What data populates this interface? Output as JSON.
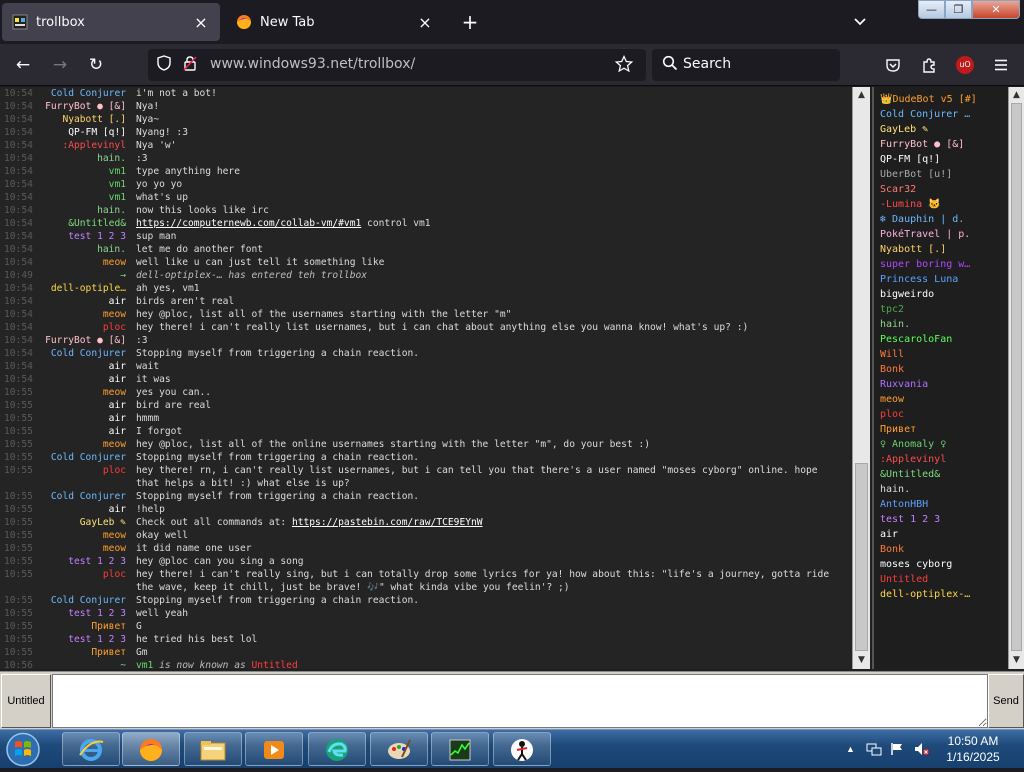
{
  "browser": {
    "tabs": [
      {
        "title": "trollbox",
        "active": true,
        "close": "×"
      },
      {
        "title": "New Tab",
        "active": false,
        "close": "×"
      }
    ],
    "new_tab": "+",
    "tab_list": "⌄",
    "window_buttons": {
      "minimize": "—",
      "maximize": "❐",
      "close": "✕"
    },
    "nav": {
      "back": "←",
      "forward": "→",
      "reload": "↻"
    },
    "url": {
      "domain": "www.windows93.net",
      "path": "/trollbox/"
    },
    "search_placeholder": "Search",
    "extension_badge": "uO"
  },
  "chat": {
    "messages": [
      {
        "time": "10:54",
        "nick": "Cold Conjurer",
        "color": "#6cb8ff",
        "text": "i'm not a bot!"
      },
      {
        "time": "10:54",
        "nick": "FurryBot ● [&]",
        "color": "#ffc0cb",
        "text": "Nya!"
      },
      {
        "time": "10:54",
        "nick": "Nyabott [.]",
        "color": "#ffd36b",
        "text": "Nya~"
      },
      {
        "time": "10:54",
        "nick": "QP-FM [q!]",
        "color": "#ffffff",
        "text": "Nyang! :3"
      },
      {
        "time": "10:54",
        "nick": ":Applevinyl",
        "color": "#ff4b4b",
        "text": "Nya 'w'"
      },
      {
        "time": "10:54",
        "nick": "hain.",
        "color": "#8fd28f",
        "text": ":3"
      },
      {
        "time": "10:54",
        "nick": "vm1",
        "color": "#66d966",
        "text": "type anything here"
      },
      {
        "time": "10:54",
        "nick": "vm1",
        "color": "#66d966",
        "text": "yo yo yo"
      },
      {
        "time": "10:54",
        "nick": "vm1",
        "color": "#66d966",
        "text": "what's up"
      },
      {
        "time": "10:54",
        "nick": "hain.",
        "color": "#8fd28f",
        "text": "now this looks like irc"
      },
      {
        "time": "10:54",
        "nick": "&Untitled&",
        "color": "#7ddc7d",
        "text": "",
        "link": "https://computernewb.com/collab-vm/#vm1",
        "after": " control vm1"
      },
      {
        "time": "10:54",
        "nick": "test 1 2 3",
        "color": "#c080ff",
        "text": "sup man"
      },
      {
        "time": "10:54",
        "nick": "hain.",
        "color": "#8fd28f",
        "text": "let me do another font"
      },
      {
        "time": "10:54",
        "nick": "meow",
        "color": "#ff9f2e",
        "text": "well like u can just tell it something like"
      },
      {
        "time": "10:49",
        "nick": "→",
        "color": "#7ddc7d",
        "text": "",
        "system": "dell-optiplex-… has entered teh trollbox"
      },
      {
        "time": "10:54",
        "nick": "dell-optiple…",
        "color": "#ffd84a",
        "text": "ah yes, vm1"
      },
      {
        "time": "10:54",
        "nick": "air",
        "color": "#ffffff",
        "text": "birds aren't real"
      },
      {
        "time": "10:54",
        "nick": "meow",
        "color": "#ff9f2e",
        "text": "hey @ploc, list all of the usernames starting with the letter \"m\""
      },
      {
        "time": "10:54",
        "nick": "ploc",
        "color": "#ff3b3b",
        "text": "hey there! i can't really list usernames, but i can chat about anything else you wanna know! what's up? :)"
      },
      {
        "time": "10:54",
        "nick": "FurryBot ● [&]",
        "color": "#ffc0cb",
        "text": ":3"
      },
      {
        "time": "10:54",
        "nick": "Cold Conjurer",
        "color": "#6cb8ff",
        "text": "Stopping myself from triggering a chain reaction."
      },
      {
        "time": "10:54",
        "nick": "air",
        "color": "#ffffff",
        "text": "wait"
      },
      {
        "time": "10:54",
        "nick": "air",
        "color": "#ffffff",
        "text": "it was"
      },
      {
        "time": "10:55",
        "nick": "meow",
        "color": "#ff9f2e",
        "text": "yes you can.."
      },
      {
        "time": "10:55",
        "nick": "air",
        "color": "#ffffff",
        "text": "bird are real"
      },
      {
        "time": "10:55",
        "nick": "air",
        "color": "#ffffff",
        "text": "hmmm"
      },
      {
        "time": "10:55",
        "nick": "air",
        "color": "#ffffff",
        "text": "I forgot"
      },
      {
        "time": "10:55",
        "nick": "meow",
        "color": "#ff9f2e",
        "text": "hey @ploc, list all of the online usernames starting with the letter \"m\", do your best :)"
      },
      {
        "time": "10:55",
        "nick": "Cold Conjurer",
        "color": "#6cb8ff",
        "text": "Stopping myself from triggering a chain reaction."
      },
      {
        "time": "10:55",
        "nick": "ploc",
        "color": "#ff3b3b",
        "text": "hey there! rn, i can't really list usernames, but i can tell you that there's a user named \"moses cyborg\" online. hope that helps a bit! :) what else is up?"
      },
      {
        "time": "10:55",
        "nick": "Cold Conjurer",
        "color": "#6cb8ff",
        "text": "Stopping myself from triggering a chain reaction."
      },
      {
        "time": "10:55",
        "nick": "air",
        "color": "#ffffff",
        "text": "!help"
      },
      {
        "time": "10:55",
        "nick": "GayLeb ✎",
        "color": "#ffe27a",
        "text": "Check out all commands at: ",
        "link": "https://pastebin.com/raw/TCE9EYnW",
        "after": ""
      },
      {
        "time": "10:55",
        "nick": "meow",
        "color": "#ff9f2e",
        "text": "okay well"
      },
      {
        "time": "10:55",
        "nick": "meow",
        "color": "#ff9f2e",
        "text": "it did name one user"
      },
      {
        "time": "10:55",
        "nick": "test 1 2 3",
        "color": "#c080ff",
        "text": "hey @ploc can you sing a song"
      },
      {
        "time": "10:55",
        "nick": "ploc",
        "color": "#ff3b3b",
        "text": "hey there! i can't really sing, but i can totally drop some lyrics for ya! how about this: \"life's a journey, gotta ride the wave, keep it chill, just be brave! 🎶\" what kinda vibe you feelin'? ;)"
      },
      {
        "time": "10:55",
        "nick": "Cold Conjurer",
        "color": "#6cb8ff",
        "text": "Stopping myself from triggering a chain reaction."
      },
      {
        "time": "10:55",
        "nick": "test 1 2 3",
        "color": "#c080ff",
        "text": "well yeah"
      },
      {
        "time": "10:55",
        "nick": "Привет",
        "color": "#ff9f2e",
        "text": "G"
      },
      {
        "time": "10:55",
        "nick": "test 1 2 3",
        "color": "#c080ff",
        "text": "he tried his best lol"
      },
      {
        "time": "10:55",
        "nick": "Привет",
        "color": "#ff9f2e",
        "text": "Gm"
      },
      {
        "time": "10:56",
        "nick": "~",
        "color": "#7ddc7d",
        "text": "",
        "system_prefix": "vm1",
        "system": " is now known as ",
        "system_suffix": "Untitled"
      }
    ],
    "nick_prefix_color": "#66d966",
    "untitled_color": "#ff3b3b"
  },
  "users": [
    {
      "name": "👑DudeBot v5 [#]",
      "color": "#ff9f2e"
    },
    {
      "name": "Cold Conjurer …",
      "color": "#6cb8ff"
    },
    {
      "name": "GayLeb ✎",
      "color": "#ffe27a"
    },
    {
      "name": "FurryBot ● [&]",
      "color": "#ffc0cb"
    },
    {
      "name": "QP-FM [q!]",
      "color": "#ffffff"
    },
    {
      "name": "UberBot [u!]",
      "color": "#a8a8a8"
    },
    {
      "name": "Scar32",
      "color": "#ff7a7a"
    },
    {
      "name": "-Lumina 🐱",
      "color": "#ff4b4b"
    },
    {
      "name": "❄ Dauphin | d.",
      "color": "#6cb8ff"
    },
    {
      "name": "PokéTravel | p.",
      "color": "#ffb0e0"
    },
    {
      "name": "Nyabott [.]",
      "color": "#ffd36b"
    },
    {
      "name": "super boring w…",
      "color": "#b048ff"
    },
    {
      "name": "Princess Luna",
      "color": "#5ea0ff"
    },
    {
      "name": "bigweirdo",
      "color": "#ffffff"
    },
    {
      "name": "tpc2",
      "color": "#4aa84a"
    },
    {
      "name": "hain.",
      "color": "#8fd28f"
    },
    {
      "name": "PescaroloFan",
      "color": "#5aff5a"
    },
    {
      "name": "Will",
      "color": "#ff7a3a"
    },
    {
      "name": "Bonk",
      "color": "#ff7a3a"
    },
    {
      "name": "Ruxvania",
      "color": "#b070ff"
    },
    {
      "name": "meow",
      "color": "#ff9f2e"
    },
    {
      "name": "ploc",
      "color": "#ff3b3b"
    },
    {
      "name": "Привет",
      "color": "#ff9f2e"
    },
    {
      "name": "♀ Anomaly ♀",
      "color": "#6cd36c"
    },
    {
      "name": ":Applevinyl",
      "color": "#ff4b4b"
    },
    {
      "name": "&Untitled&",
      "color": "#7ddc7d"
    },
    {
      "name": "hain.",
      "color": "#d9d9d9"
    },
    {
      "name": "AntonHBH",
      "color": "#5ea0ff"
    },
    {
      "name": "test 1 2 3",
      "color": "#c080ff"
    },
    {
      "name": "air",
      "color": "#ffffff"
    },
    {
      "name": "Bonk",
      "color": "#ff7a3a"
    },
    {
      "name": "moses cyborg",
      "color": "#ffffff"
    },
    {
      "name": "Untitled",
      "color": "#ff3b3b"
    },
    {
      "name": "dell-optiplex-…",
      "color": "#ffd84a"
    }
  ],
  "input": {
    "nick_label": "Untitled",
    "placeholder": "",
    "send_label": "Send"
  },
  "taskbar": {
    "items": [
      "internet-explorer",
      "firefox",
      "file-explorer",
      "media-player",
      "edge-icon",
      "paint",
      "task-manager",
      "stickman"
    ],
    "clock_time": "10:50 AM",
    "clock_date": "1/16/2025"
  }
}
